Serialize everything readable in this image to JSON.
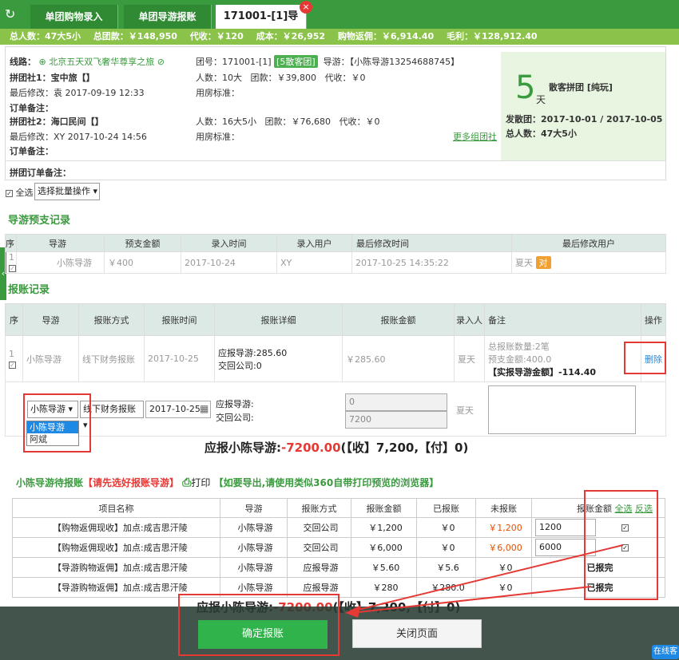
{
  "tabs": {
    "tab1": "单团购物录入",
    "tab2": "单团导游报账",
    "tab3": "171001-[1]导",
    "close": "×"
  },
  "summary": {
    "people": "总人数：47大5小",
    "total_fee": "总团款：￥148,950",
    "collect": "代收：￥120",
    "cost": "成本：￥26,952",
    "rebate": "购物返佣：￥6,914.40",
    "profit": "毛利：￥128,912.40"
  },
  "info": {
    "route_label": "线路：",
    "route_name": "北京五天双飞奢华尊享之旅",
    "group_no": "团号：171001-[1]",
    "group_badge": "[5散客团]",
    "guide": "导游：【小陈导游13254688745】",
    "agent1": "拼团社1：宝中旅【】",
    "agent1_people": "人数：10大",
    "agent1_fee": "团款：￥39,800",
    "agent1_collect": "代收：￥0",
    "last_mod1": "最后修改：袁 2017-09-19 12:33",
    "room1": "用房标准：",
    "order_note1": "订单备注：",
    "agent2": "拼团社2：海口民间【】",
    "agent2_people": "人数：16大5小",
    "agent2_fee": "团款：￥76,680",
    "agent2_collect": "代收：￥0",
    "last_mod2": "最后修改：XY 2017-10-24 14:56",
    "room2": "用房标准：",
    "more_agents": "更多组团社",
    "order_note2": "订单备注：",
    "group_order_note": "拼团订单备注：",
    "days_num": "5",
    "days_unit": "天",
    "group_type": "散客拼团 [纯玩]",
    "depart": "发散团：2017-10-01 / 2017-10-05",
    "total_people": "总人数：47大5小"
  },
  "batch": {
    "select_all": "全选",
    "batch_op": "选择批量操作"
  },
  "advance": {
    "title": "导游预支记录",
    "headers": [
      "序",
      "导游",
      "预支金额",
      "录入时间",
      "录入用户",
      "最后修改时间",
      "最后修改用户"
    ],
    "row": {
      "no": "1",
      "guide": "小陈导游",
      "amount": "￥400",
      "time": "2017-10-24",
      "user": "XY",
      "modtime": "2017-10-25 14:35:22",
      "moduser": "夏天",
      "tag": "对"
    }
  },
  "reimb": {
    "title": "报账记录",
    "headers": [
      "序",
      "导游",
      "报账方式",
      "报账时间",
      "报账详细",
      "报账金额",
      "录入人",
      "备注",
      "操作"
    ],
    "row": {
      "no": "1",
      "guide": "小陈导游",
      "method": "线下财务报账",
      "time": "2017-10-25",
      "detail1": "应报导游:285.60",
      "detail2": "交回公司:0",
      "amount": "￥285.60",
      "user": "夏天",
      "note1": "总报账数量:2笔",
      "note2": "预支金额:400.0",
      "note3": "【实报导游金额】-114.40",
      "delete": "删除"
    },
    "edit": {
      "guide_select": "小陈导游",
      "method_select": "线下财务报账",
      "date": "2017-10-25",
      "due_label": "应报导游:",
      "return_label": "交回公司:",
      "due_val": "0",
      "return_val": "7200",
      "user": "夏天"
    },
    "dropdown": [
      "小陈导游",
      "阿斌"
    ]
  },
  "total1": {
    "prefix": "应报小陈导游:",
    "amount": "-7200.00",
    "suffix": "(【收】7,200,【付】0)"
  },
  "pending": {
    "title": "小陈导游待报账",
    "warn": "【请先选好报账导游】",
    "print": "打印",
    "tip": "【如要导出,请使用类似360自带打印预览的浏览器】",
    "headers": [
      "项目名称",
      "导游",
      "报账方式",
      "报账金额",
      "已报账",
      "未报账",
      "报账金额"
    ],
    "select_all": "全选",
    "invert": "反选",
    "rows": [
      {
        "name": "【购物返佣现收】加点:成吉思汗陵",
        "guide": "小陈导游",
        "method": "交回公司",
        "amount": "￥1,200",
        "paid": "￥0",
        "unpaid": "￥1,200",
        "input": "1200"
      },
      {
        "name": "【购物返佣现收】加点:成吉思汗陵",
        "guide": "小陈导游",
        "method": "交回公司",
        "amount": "￥6,000",
        "paid": "￥0",
        "unpaid": "￥6,000",
        "input": "6000"
      },
      {
        "name": "【导游购物返佣】加点:成吉思汗陵",
        "guide": "小陈导游",
        "method": "应报导游",
        "amount": "￥5.60",
        "paid": "￥5.6",
        "unpaid": "￥0",
        "done": "已报完"
      },
      {
        "name": "【导游购物返佣】加点:成吉思汗陵",
        "guide": "小陈导游",
        "method": "应报导游",
        "amount": "￥280",
        "paid": "￥280.0",
        "unpaid": "￥0",
        "done": "已报完"
      }
    ]
  },
  "total2": {
    "prefix": "应报小陈导游:",
    "amount": "-7200.00",
    "suffix": "(【收】7,200,【付】0)"
  },
  "footer": {
    "confirm": "确定报账",
    "close": "关闭页面",
    "online": "在线客"
  },
  "colors": {
    "brand": "#3a9a3e",
    "accent_red": "#e53935",
    "summary": "#8bc34a"
  }
}
